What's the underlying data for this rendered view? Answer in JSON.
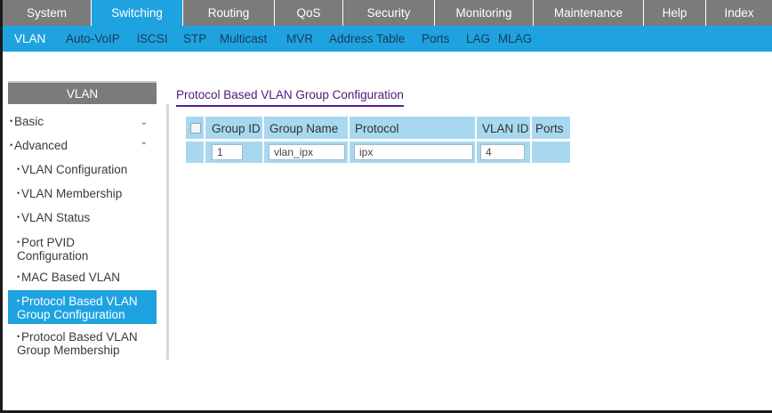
{
  "top_menu": {
    "items": [
      "System",
      "Switching",
      "Routing",
      "QoS",
      "Security",
      "Monitoring",
      "Maintenance",
      "Help",
      "Index"
    ],
    "active": "Switching"
  },
  "sub_menu": {
    "items": [
      "VLAN",
      "Auto-VoIP",
      "iSCSI",
      "STP",
      "Multicast",
      "MVR",
      "Address Table",
      "Ports",
      "LAG",
      "MLAG"
    ],
    "active": "VLAN"
  },
  "sidebar": {
    "title": "VLAN",
    "basic": "Basic",
    "advanced": "Advanced",
    "items": [
      "VLAN Configuration",
      "VLAN Membership",
      "VLAN Status",
      "Port PVID Configuration",
      "MAC Based VLAN",
      "Protocol Based VLAN Group Configuration",
      "Protocol Based VLAN Group Membership"
    ],
    "active": "Protocol Based VLAN Group Configuration"
  },
  "content": {
    "title": "Protocol Based VLAN Group Configuration",
    "columns": [
      "Group ID",
      "Group Name",
      "Protocol",
      "VLAN ID",
      "Ports"
    ],
    "row": {
      "group_id": "1",
      "group_name": "vlan_ipx",
      "protocol": "ipx",
      "vlan_id": "4",
      "ports": ""
    }
  }
}
